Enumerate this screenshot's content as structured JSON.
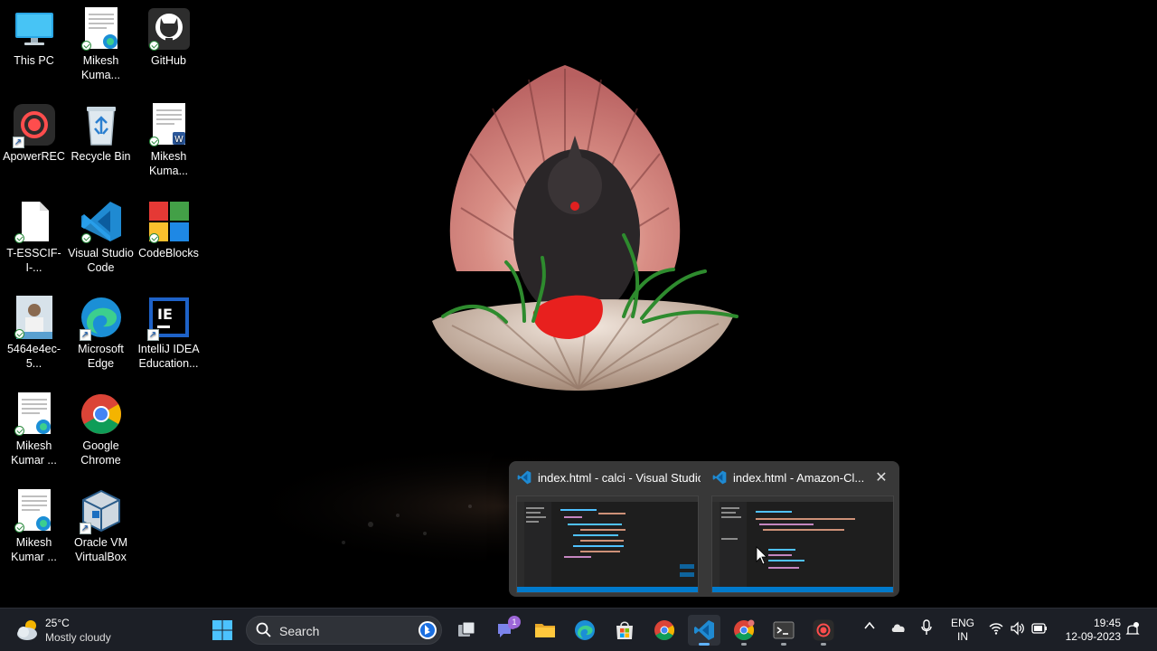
{
  "desktop": {
    "icons": [
      {
        "label": "This PC",
        "icon": "computer-icon"
      },
      {
        "label": "Mikesh Kuma...",
        "icon": "edge-document-icon"
      },
      {
        "label": "GitHub",
        "icon": "github-icon"
      },
      {
        "label": "ApowerREC",
        "icon": "apowerrec-icon"
      },
      {
        "label": "Recycle Bin",
        "icon": "recycle-bin-icon"
      },
      {
        "label": "Mikesh Kuma...",
        "icon": "word-document-icon"
      },
      {
        "label": "T-ESSCIF-I-...",
        "icon": "blank-file-icon"
      },
      {
        "label": "Visual Studio Code",
        "icon": "vscode-icon"
      },
      {
        "label": "CodeBlocks",
        "icon": "codeblocks-icon"
      },
      {
        "label": "5464e4ec-5...",
        "icon": "photo-icon"
      },
      {
        "label": "Microsoft Edge",
        "icon": "edge-icon"
      },
      {
        "label": "IntelliJ IDEA Education...",
        "icon": "intellij-icon"
      },
      {
        "label": "Mikesh Kumar ...",
        "icon": "edge-document-icon"
      },
      {
        "label": "Google Chrome",
        "icon": "chrome-icon"
      },
      {
        "label": "Mikesh Kumar ...",
        "icon": "edge-document-icon"
      },
      {
        "label": "Oracle VM VirtualBox",
        "icon": "virtualbox-icon"
      }
    ],
    "icon_text": {
      "intellij_mark": "IE"
    }
  },
  "thumbnail_popup": {
    "windows": [
      {
        "title": "index.html - calci - Visual Studio...",
        "icon": "vscode-icon"
      },
      {
        "title": "index.html - Amazon-Cl...",
        "icon": "vscode-icon"
      }
    ],
    "close_glyph": "✕"
  },
  "taskbar": {
    "weather": {
      "temperature": "25°C",
      "condition": "Mostly cloudy",
      "icon": "cloud-sun-icon"
    },
    "search_placeholder": "Search",
    "apps": [
      {
        "name": "start",
        "icon": "windows-start-icon"
      },
      {
        "name": "bing",
        "icon": "bing-icon"
      },
      {
        "name": "task-view",
        "icon": "task-view-icon"
      },
      {
        "name": "teams-chat",
        "icon": "teams-chat-icon",
        "badge": "1"
      },
      {
        "name": "file-explorer",
        "icon": "folder-icon"
      },
      {
        "name": "edge",
        "icon": "edge-icon"
      },
      {
        "name": "microsoft-store",
        "icon": "store-icon"
      },
      {
        "name": "chrome",
        "icon": "chrome-icon"
      },
      {
        "name": "vscode",
        "icon": "vscode-icon"
      },
      {
        "name": "chrome-profile",
        "icon": "chrome-icon"
      },
      {
        "name": "terminal",
        "icon": "terminal-icon"
      },
      {
        "name": "apowerrec",
        "icon": "apowerrec-icon"
      }
    ],
    "tray": {
      "language_line1": "ENG",
      "language_line2": "IN",
      "time": "19:45",
      "date": "12-09-2023"
    },
    "accent_color": "#5fb2ff"
  }
}
